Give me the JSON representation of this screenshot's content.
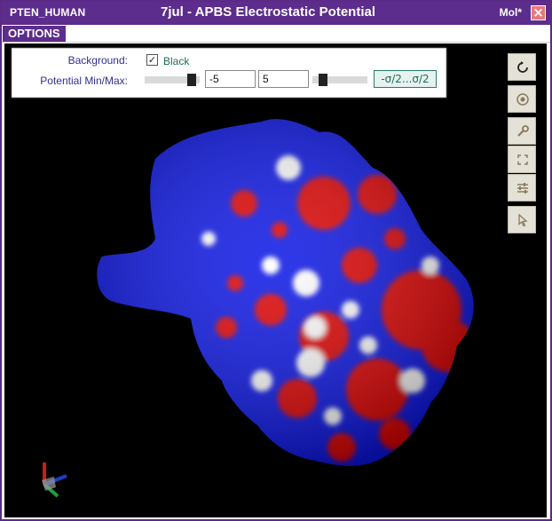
{
  "window": {
    "left_title": "PTEN_HUMAN",
    "title": "7jul - APBS Electrostatic Potential",
    "right_title": "Mol*",
    "close_icon": "close-icon"
  },
  "menu": {
    "options_label": "OPTIONS"
  },
  "controls": {
    "background_label": "Background:",
    "background_checked": true,
    "background_value": "Black",
    "potential_label": "Potential Min/Max:",
    "min_value": "-5",
    "max_value": "5",
    "range_button_label": "-σ/2...σ/2"
  },
  "toolbar": {
    "buttons": [
      "reset-view-icon",
      "screenshot-icon",
      "settings-wrench-icon",
      "fullscreen-icon",
      "controls-sliders-icon",
      "select-pointer-icon"
    ]
  },
  "colors": {
    "title_bar": "#5c2d8c",
    "negative_potential": "#e00000",
    "positive_potential": "#0a14e6",
    "neutral": "#ffffff"
  }
}
